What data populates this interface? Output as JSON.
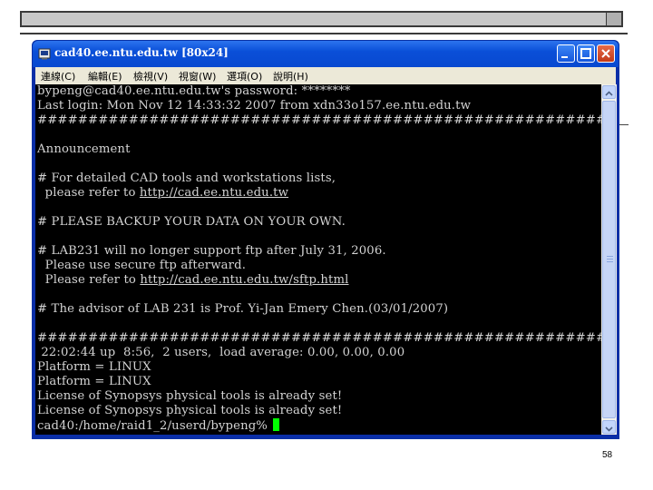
{
  "window": {
    "title": "cad40.ee.ntu.edu.tw [80x24]"
  },
  "menu": [
    "連線(C)",
    "編輯(E)",
    "檢視(V)",
    "視窗(W)",
    "選項(O)",
    "說明(H)"
  ],
  "terminal": {
    "lines": [
      "bypeng@cad40.ee.ntu.edu.tw's password: ********",
      "Last login: Mon Nov 12 14:33:32 2007 from xdn33o157.ee.ntu.edu.tw",
      "##########################################################",
      "",
      "Announcement",
      "",
      "# For detailed CAD tools and workstations lists,",
      "  please refer to ",
      "",
      "# PLEASE BACKUP YOUR DATA ON YOUR OWN.",
      "",
      "# LAB231 will no longer support ftp after July 31, 2006.",
      "  Please use secure ftp afterward.",
      "  Please refer to ",
      "",
      "# The advisor of LAB 231 is Prof. Yi-Jan Emery Chen.(03/01/2007)",
      "",
      "##########################################################",
      " 22:02:44 up  8:56,  2 users,  load average: 0.00, 0.00, 0.00",
      "Platform = LINUX",
      "Platform = LINUX",
      "License of Synopsys physical tools is already set!",
      "License of Synopsys physical tools is already set!",
      "cad40:/home/raid1_2/userd/bypeng% "
    ],
    "link1": "http://cad.ee.ntu.edu.tw",
    "link2": "http://cad.ee.ntu.edu.tw/sftp.html"
  },
  "slide": {
    "page_number": "58"
  },
  "colors": {
    "titlebar": "#0a4fd8",
    "terminal_bg": "#000000",
    "terminal_text": "#d4d4d4",
    "cursor": "#00ff00"
  }
}
